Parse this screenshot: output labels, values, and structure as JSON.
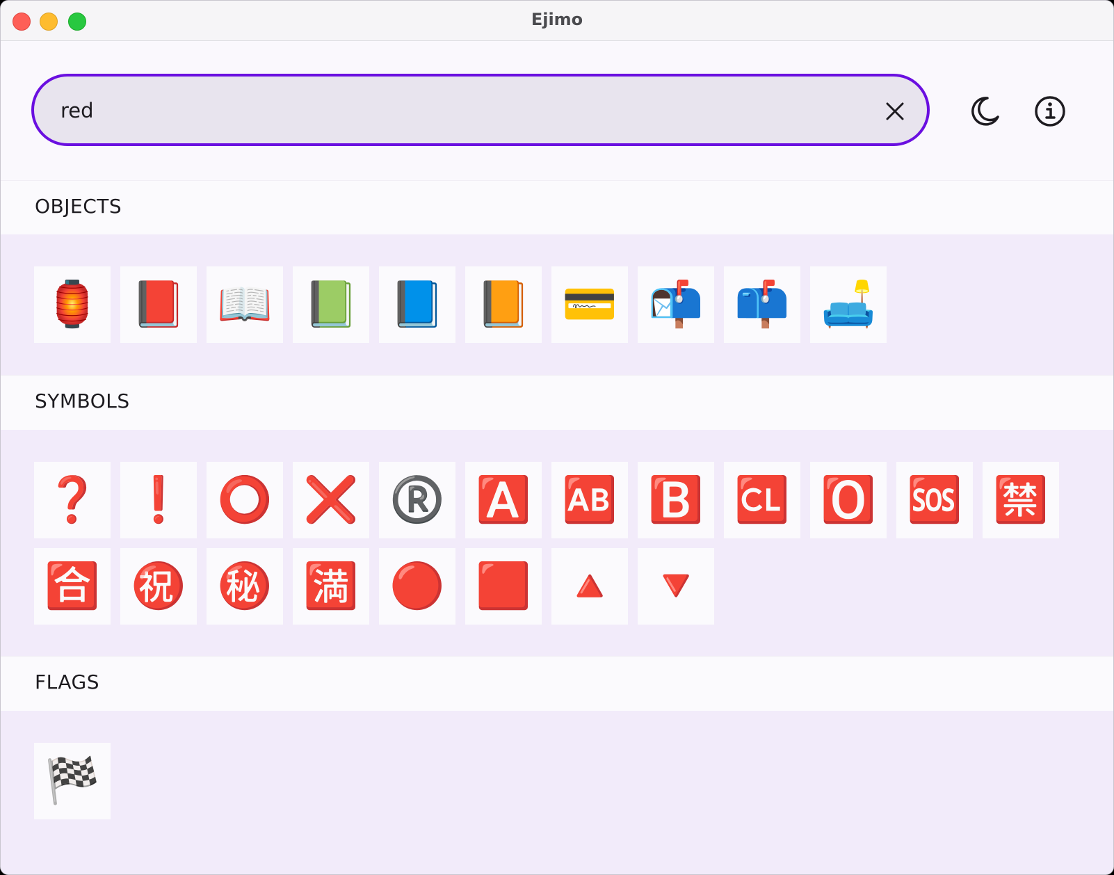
{
  "window": {
    "title": "Ejimo"
  },
  "search": {
    "value": "red"
  },
  "sections": [
    {
      "title": "OBJECTS",
      "emojis": [
        "🏮",
        "📕",
        "📖",
        "📗",
        "📘",
        "📙",
        "💳",
        "📬",
        "📫",
        "🛋️"
      ]
    },
    {
      "title": "SYMBOLS",
      "emojis": [
        "❓",
        "❗",
        "⭕",
        "❌",
        "®️",
        "🅰️",
        "🆎",
        "🅱️",
        "🆑",
        "🅾️",
        "🆘",
        "🈲",
        "🈴",
        "㊗️",
        "㊙️",
        "🈵",
        "🔴",
        "🟥",
        "🔺",
        "🔻"
      ]
    },
    {
      "title": "FLAGS",
      "emojis": [
        "🏁"
      ]
    }
  ],
  "colors": {
    "accent": "#6a0fe0",
    "section_bg": "#f2ebfa",
    "tile_bg": "#fbfafd"
  },
  "icons": {
    "clear": "close-icon",
    "theme": "moon-icon",
    "about": "info-icon"
  }
}
